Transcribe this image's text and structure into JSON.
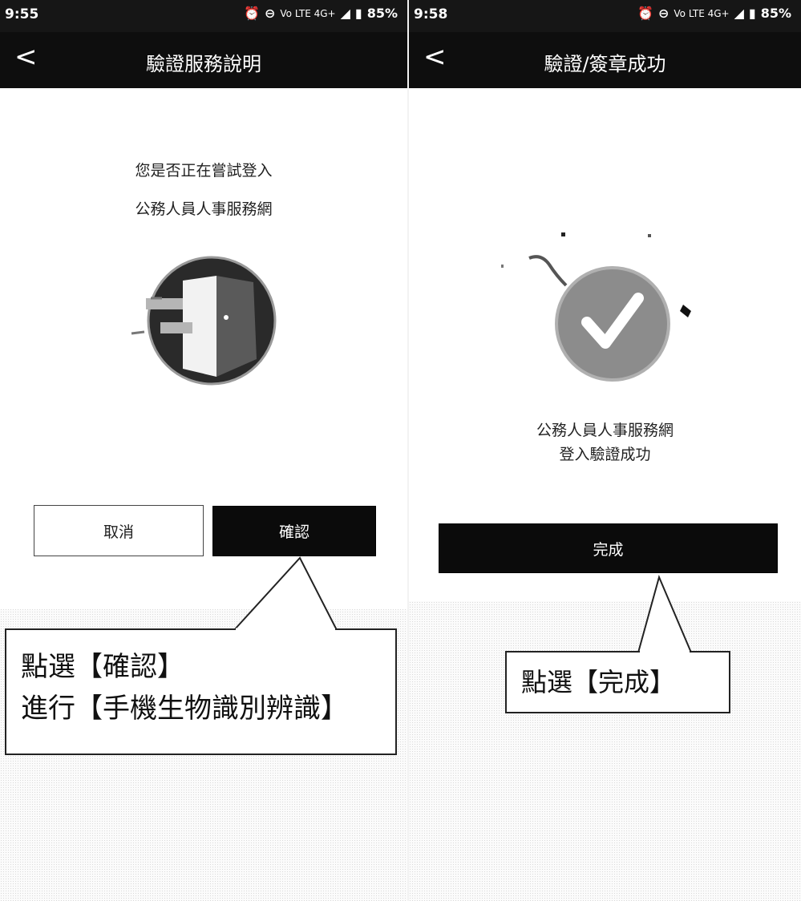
{
  "left": {
    "status": {
      "time": "9:55",
      "network": "Vo LTE 4G+",
      "battery": "85%"
    },
    "nav": {
      "back_glyph": "<",
      "title": "驗證服務說明"
    },
    "prompt": [
      "您是否正在嘗試登入",
      "公務人員人事服務網"
    ],
    "illustration_icon": "door-enter-icon",
    "buttons": {
      "cancel": "取消",
      "confirm": "確認"
    },
    "callout": [
      "點選【確認】",
      "進行【手機生物識別辨識】"
    ]
  },
  "right": {
    "status": {
      "time": "9:58",
      "network": "Vo LTE 4G+",
      "battery": "85%"
    },
    "nav": {
      "back_glyph": "<",
      "title": "驗證/簽章成功"
    },
    "success_icon": "checkmark-circle-icon",
    "message": [
      "公務人員人事服務網",
      "登入驗證成功"
    ],
    "buttons": {
      "done": "完成"
    },
    "callout": [
      "點選【完成】"
    ]
  },
  "colors": {
    "bar": "#111111",
    "button_dark": "#0b0b0b",
    "check_circle": "#8c8c8c"
  }
}
